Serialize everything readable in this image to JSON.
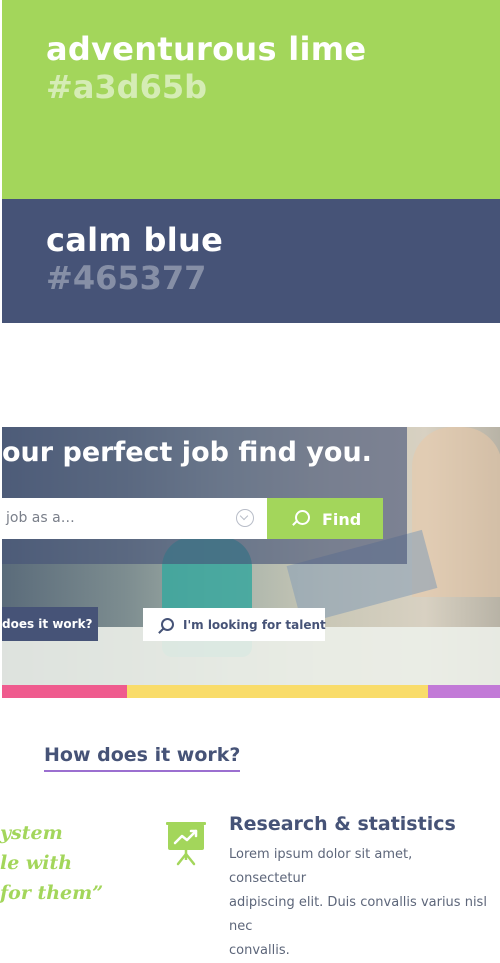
{
  "palette": [
    {
      "name": "adventurous lime",
      "hex": "#a3d65b"
    },
    {
      "name": "calm blue",
      "hex": "#465377"
    }
  ],
  "hero": {
    "title": "our perfect job find you.",
    "search_text": "job as a…",
    "find_label": "Find",
    "how_label": "does it work?",
    "talent_label": "I'm looking for talent"
  },
  "strip_colors": [
    "#ef5b8e",
    "#f9dc6a",
    "#c27ad7"
  ],
  "section": {
    "title": "How does it work?"
  },
  "quote": {
    "lines": [
      "ystem",
      "le with",
      " for them”"
    ]
  },
  "feature": {
    "title": "Research & statistics",
    "desc_lines": [
      "Lorem ipsum dolor sit amet, consectetur",
      "adipiscing elit. Duis convallis varius nisl nec",
      "convallis."
    ],
    "icon": "presentation-chart-icon"
  }
}
